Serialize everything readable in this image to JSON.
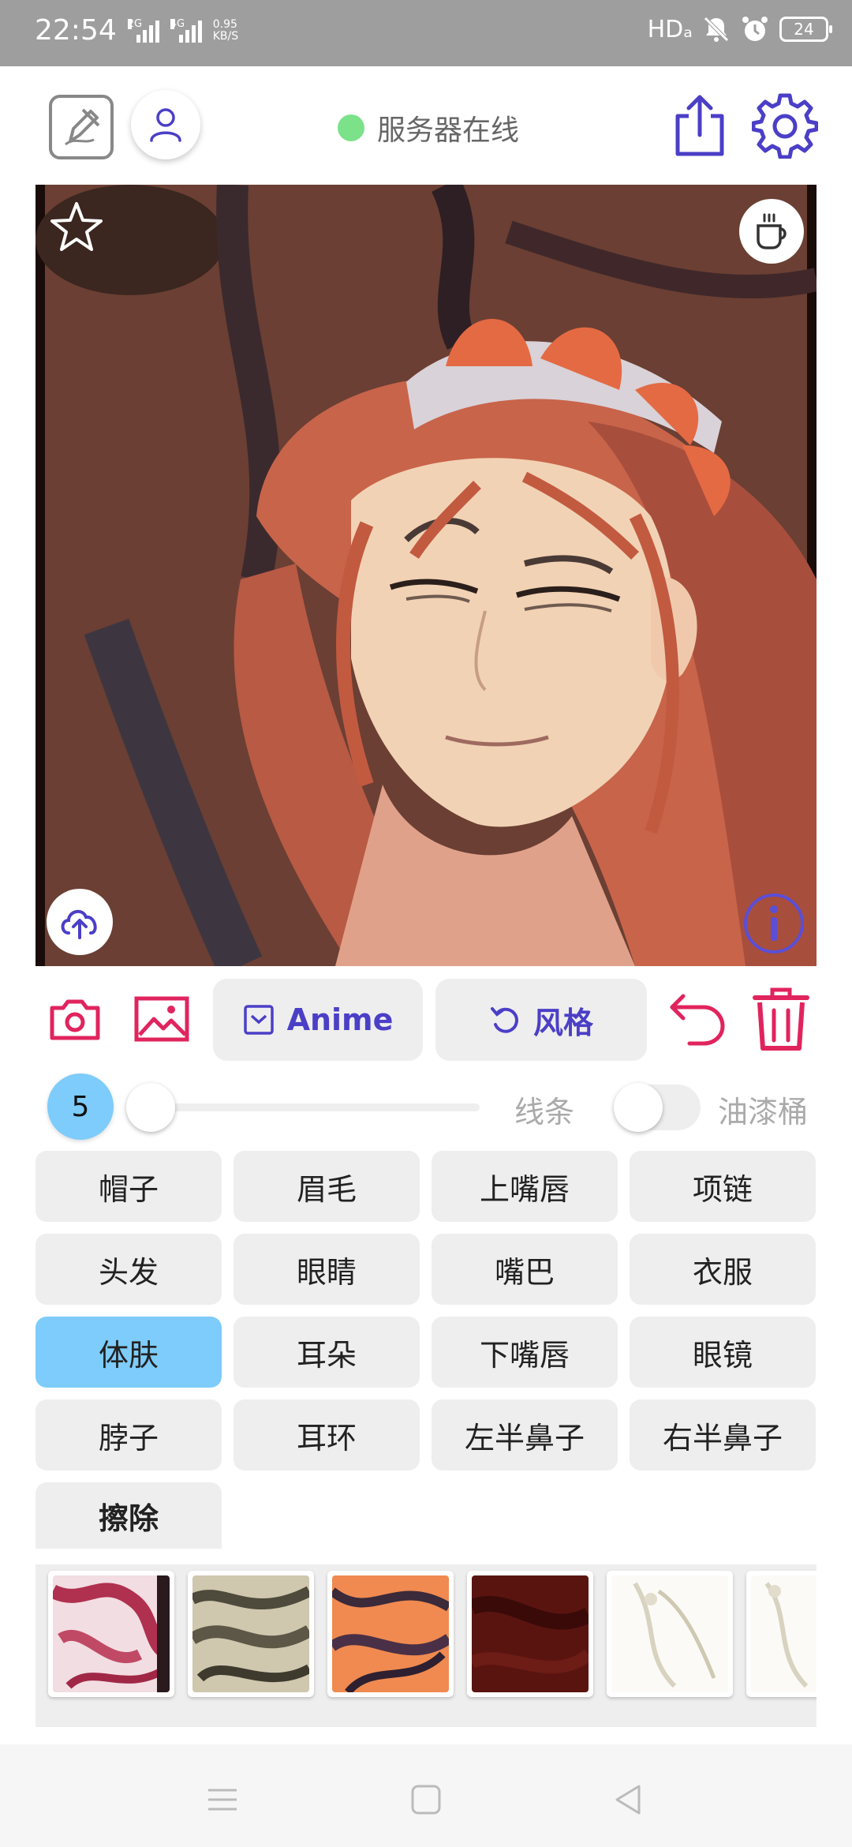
{
  "status_bar": {
    "time": "22:54",
    "signal1": "2G",
    "signal2": "4G",
    "net_speed_value": "0.95",
    "net_speed_unit": "KB/S",
    "hd": "HDₐ",
    "battery": "24"
  },
  "header": {
    "server_status": "服务器在线",
    "server_status_color": "#7be28a"
  },
  "toolbar": {
    "anime_label": "Anime",
    "style_label": "风格",
    "accent_color": "#4b3fc7",
    "danger_color": "#e0245e"
  },
  "brush": {
    "size": "5",
    "slider_level": 0.0,
    "line_label": "线条",
    "bucket_label": "油漆桶",
    "bucket_enabled": false
  },
  "parts": [
    {
      "label": "帽子"
    },
    {
      "label": "眉毛"
    },
    {
      "label": "上嘴唇"
    },
    {
      "label": "项链"
    },
    {
      "label": "头发"
    },
    {
      "label": "眼睛"
    },
    {
      "label": "嘴巴"
    },
    {
      "label": "衣服"
    },
    {
      "label": "体肤",
      "active": true
    },
    {
      "label": "耳朵"
    },
    {
      "label": "下嘴唇"
    },
    {
      "label": "眼镜"
    },
    {
      "label": "脖子"
    },
    {
      "label": "耳环"
    },
    {
      "label": "左半鼻子"
    },
    {
      "label": "右半鼻子"
    },
    {
      "label": "擦除"
    }
  ],
  "icons": {
    "edit": "edit-square-icon",
    "user": "user-icon",
    "share": "share-icon",
    "settings": "gear-icon",
    "favorite": "star-icon",
    "coffee": "coffee-cup-icon",
    "upload": "cloud-upload-icon",
    "info": "info-icon",
    "camera": "camera-icon",
    "gallery": "image-icon",
    "undo": "undo-icon",
    "delete": "trash-icon"
  }
}
